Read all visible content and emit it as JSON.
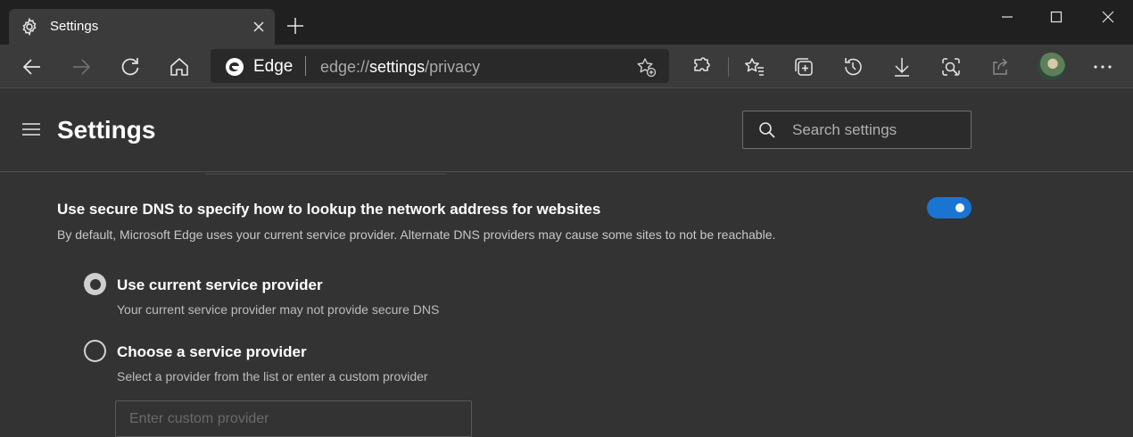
{
  "window": {
    "tab": {
      "title": "Settings",
      "icon": "gear-icon"
    },
    "controls": [
      "minimize-icon",
      "maximize-icon",
      "close-icon"
    ]
  },
  "toolbar": {
    "address": {
      "brand": "Edge",
      "url_scheme": "edge://",
      "url_host": "settings",
      "url_path": "/privacy"
    },
    "icons": [
      "back-icon",
      "forward-icon",
      "refresh-icon",
      "home-icon",
      "add-favorite-icon",
      "extensions-icon",
      "favorites-icon",
      "collections-icon",
      "history-icon",
      "downloads-icon",
      "web-capture-icon",
      "share-icon",
      "avatar",
      "more-icon"
    ]
  },
  "header": {
    "title": "Settings",
    "search_placeholder": "Search settings"
  },
  "secure_dns": {
    "title": "Use secure DNS to specify how to lookup the network address for websites",
    "description": "By default, Microsoft Edge uses your current service provider. Alternate DNS providers may cause some sites to not be reachable.",
    "enabled": true,
    "options": [
      {
        "title": "Use current service provider",
        "description": "Your current service provider may not provide secure DNS",
        "selected": true
      },
      {
        "title": "Choose a service provider",
        "description": "Select a provider from the list or enter a custom provider",
        "selected": false
      }
    ],
    "custom_provider_placeholder": "Enter custom provider"
  },
  "colors": {
    "accent": "#1a74d2",
    "background": "#333333",
    "titlebar": "#202020"
  }
}
